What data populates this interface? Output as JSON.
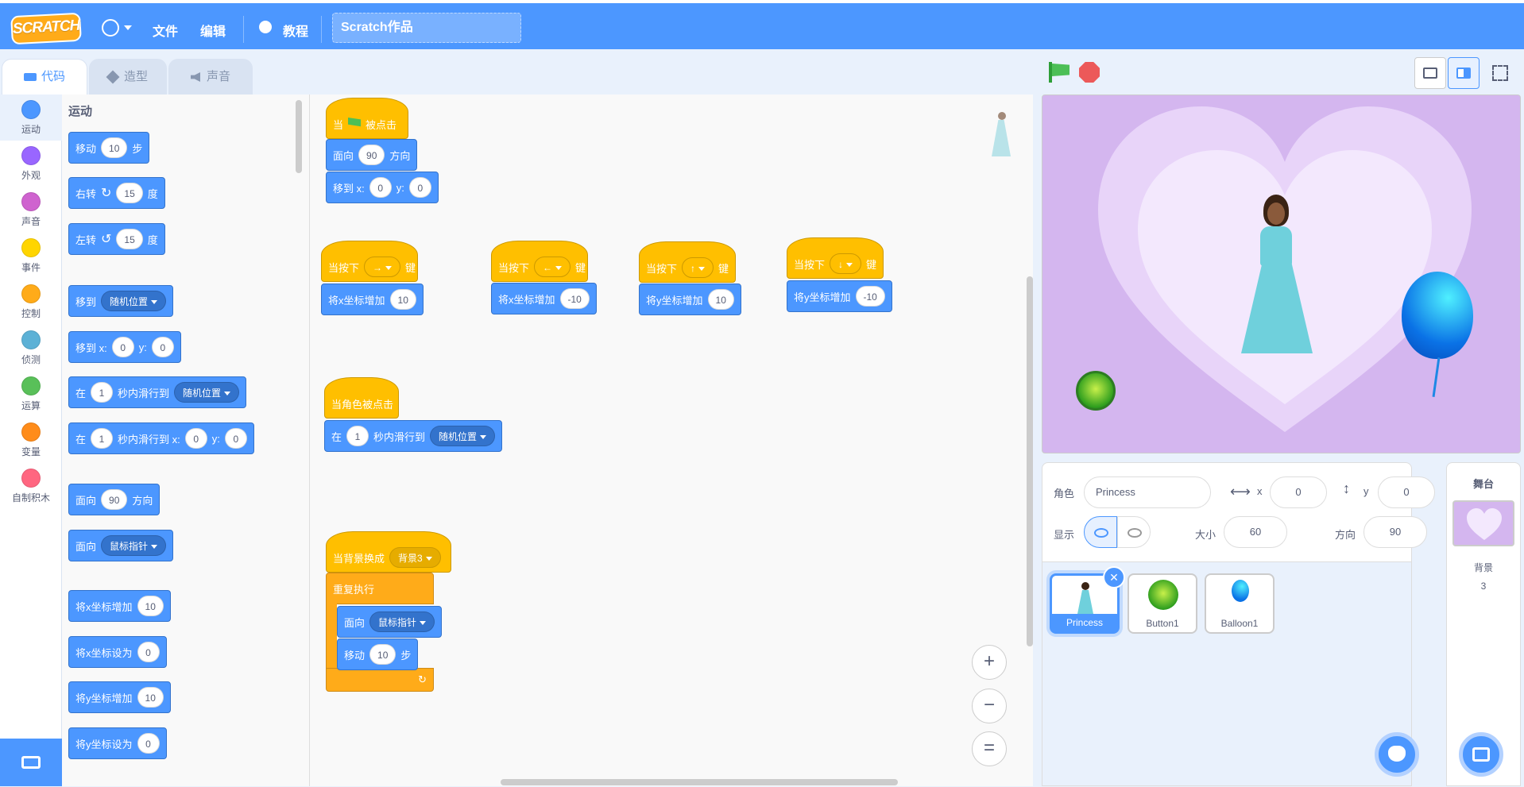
{
  "menubar": {
    "logo": "SCRATCH",
    "file": "文件",
    "edit": "编辑",
    "tutorials": "教程",
    "project_title": "Scratch作品"
  },
  "tabs": {
    "code": "代码",
    "costumes": "造型",
    "sounds": "声音"
  },
  "categories": [
    {
      "label": "运动",
      "color": "#4c97ff"
    },
    {
      "label": "外观",
      "color": "#9966ff"
    },
    {
      "label": "声音",
      "color": "#cf63cf"
    },
    {
      "label": "事件",
      "color": "#ffd500"
    },
    {
      "label": "控制",
      "color": "#ffab19"
    },
    {
      "label": "侦测",
      "color": "#5cb1d6"
    },
    {
      "label": "运算",
      "color": "#59c059"
    },
    {
      "label": "变量",
      "color": "#ff8c1a"
    },
    {
      "label": "自制积木",
      "color": "#ff6680"
    }
  ],
  "palette": {
    "heading": "运动",
    "move": "移动",
    "move_val": "10",
    "steps": "步",
    "turn_right": "右转",
    "turn_right_val": "15",
    "degrees": "度",
    "turn_left": "左转",
    "turn_left_val": "15",
    "goto": "移到",
    "goto_dd": "随机位置",
    "goto_xy": "移到 x:",
    "x0": "0",
    "y_lbl": "y:",
    "y0": "0",
    "glide_in": "在",
    "glide_secs": "1",
    "glide_to": "秒内滑行到",
    "glide_dd": "随机位置",
    "glide_to_xy": "秒内滑行到 x:",
    "point_dir": "面向",
    "point_val": "90",
    "direction": "方向",
    "point_towards": "面向",
    "point_towards_dd": "鼠标指针",
    "change_x": "将x坐标增加",
    "change_x_val": "10",
    "set_x": "将x坐标设为",
    "set_x_val": "0",
    "change_y": "将y坐标增加",
    "change_y_val": "10",
    "set_y": "将y坐标设为",
    "set_y_val": "0"
  },
  "workspace": {
    "when": "当",
    "flag_clicked": "被点击",
    "face": "面向",
    "face_val": "90",
    "direction": "方向",
    "goto_xy": "移到 x:",
    "gx": "0",
    "y_lbl": "y:",
    "gy": "0",
    "when_key": "当按下",
    "key": "键",
    "key_right": "→",
    "key_left": "←",
    "key_up": "↑",
    "key_down": "↓",
    "change_x": "将x坐标增加",
    "change_y": "将y坐标增加",
    "v10": "10",
    "vneg10": "-10",
    "when_sprite_clicked": "当角色被点击",
    "glide_in": "在",
    "glide_secs": "1",
    "glide_to": "秒内滑行到",
    "glide_dd": "随机位置",
    "when_backdrop": "当背景换成",
    "backdrop_dd": "背景3",
    "forever": "重复执行",
    "point_towards": "面向",
    "towards_dd": "鼠标指针",
    "move": "移动",
    "move_val": "10",
    "steps": "步",
    "zoom_in": "+",
    "zoom_out": "−",
    "zoom_reset": "="
  },
  "sprite_info": {
    "sprite_label": "角色",
    "sprite_name": "Princess",
    "x_label": "x",
    "x_val": "0",
    "y_label": "y",
    "y_val": "0",
    "show_label": "显示",
    "size_label": "大小",
    "size_val": "60",
    "dir_label": "方向",
    "dir_val": "90"
  },
  "sprites": [
    {
      "name": "Princess"
    },
    {
      "name": "Button1"
    },
    {
      "name": "Balloon1"
    }
  ],
  "stage_pane": {
    "title": "舞台",
    "backdrop_label": "背景",
    "backdrop_count": "3"
  }
}
